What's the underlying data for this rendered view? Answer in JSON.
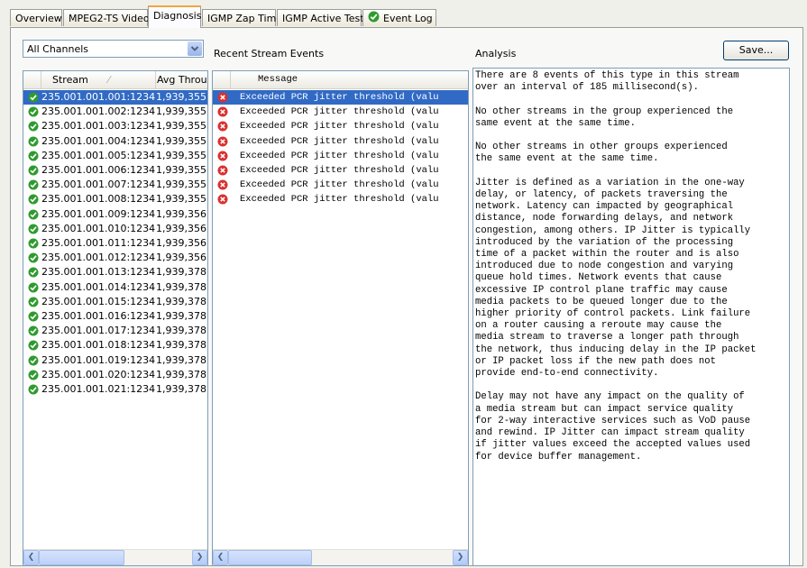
{
  "tabs": [
    {
      "label": "Overview"
    },
    {
      "label": "MPEG2-TS Video"
    },
    {
      "label": "Diagnosis"
    },
    {
      "label": "IGMP Zap Time"
    },
    {
      "label": "IGMP Active Test"
    },
    {
      "label": "Event Log"
    }
  ],
  "channel_select": {
    "value": "All Channels"
  },
  "recent_events_label": "Recent Stream Events",
  "analysis_label": "Analysis",
  "save_button": "Save...",
  "stream_table": {
    "columns": [
      "Stream",
      "Avg Throug"
    ],
    "rows": [
      {
        "stream": "235.001.001.001:1234",
        "avg": "1,939,355"
      },
      {
        "stream": "235.001.001.002:1234",
        "avg": "1,939,355"
      },
      {
        "stream": "235.001.001.003:1234",
        "avg": "1,939,355"
      },
      {
        "stream": "235.001.001.004:1234",
        "avg": "1,939,355"
      },
      {
        "stream": "235.001.001.005:1234",
        "avg": "1,939,355"
      },
      {
        "stream": "235.001.001.006:1234",
        "avg": "1,939,355"
      },
      {
        "stream": "235.001.001.007:1234",
        "avg": "1,939,355"
      },
      {
        "stream": "235.001.001.008:1234",
        "avg": "1,939,355"
      },
      {
        "stream": "235.001.001.009:1234",
        "avg": "1,939,356"
      },
      {
        "stream": "235.001.001.010:1234",
        "avg": "1,939,356"
      },
      {
        "stream": "235.001.001.011:1234",
        "avg": "1,939,356"
      },
      {
        "stream": "235.001.001.012:1234",
        "avg": "1,939,356"
      },
      {
        "stream": "235.001.001.013:1234",
        "avg": "1,939,378"
      },
      {
        "stream": "235.001.001.014:1234",
        "avg": "1,939,378"
      },
      {
        "stream": "235.001.001.015:1234",
        "avg": "1,939,378"
      },
      {
        "stream": "235.001.001.016:1234",
        "avg": "1,939,378"
      },
      {
        "stream": "235.001.001.017:1234",
        "avg": "1,939,378"
      },
      {
        "stream": "235.001.001.018:1234",
        "avg": "1,939,378"
      },
      {
        "stream": "235.001.001.019:1234",
        "avg": "1,939,378"
      },
      {
        "stream": "235.001.001.020:1234",
        "avg": "1,939,378"
      },
      {
        "stream": "235.001.001.021:1234",
        "avg": "1,939,378"
      }
    ]
  },
  "events_table": {
    "column": "Message",
    "rows": [
      "Exceeded PCR jitter threshold (valu",
      "Exceeded PCR jitter threshold (valu",
      "Exceeded PCR jitter threshold (valu",
      "Exceeded PCR jitter threshold (valu",
      "Exceeded PCR jitter threshold (valu",
      "Exceeded PCR jitter threshold (valu",
      "Exceeded PCR jitter threshold (valu",
      "Exceeded PCR jitter threshold (valu"
    ]
  },
  "analysis_text": "There are 8 events of this type in this stream\nover an interval of 185 millisecond(s).\n\nNo other streams in the group experienced the\nsame event at the same time.\n\nNo other streams in other groups experienced\nthe same event at the same time.\n\nJitter is defined as a variation in the one-way\ndelay, or latency, of packets traversing the\nnetwork. Latency can impacted by geographical\ndistance, node forwarding delays, and network\ncongestion, among others. IP Jitter is typically\nintroduced by the variation of the processing\ntime of a packet within the router and is also\nintroduced due to node congestion and varying\nqueue hold times. Network events that cause\nexcessive IP control plane traffic may cause\nmedia packets to be queued longer due to the\nhigher priority of control packets. Link failure\non a router causing a reroute may cause the\nmedia stream to traverse a longer path through\nthe network, thus inducing delay in the IP packet\nor IP packet loss if the new path does not\nprovide end-to-end connectivity.\n\nDelay may not have any impact on the quality of\na media stream but can impact service quality\nfor 2-way interactive services such as VoD pause\nand rewind. IP Jitter can impact stream quality\nif jitter values exceed the accepted values used\nfor device buffer management.",
  "colors": {
    "selection": "#316ac5",
    "ok": "#2e9b2e",
    "error": "#d9302f",
    "active_tab_accent": "#f1a73f"
  },
  "icons": {
    "stream_status": "check-circle-icon",
    "event_status": "error-circle-icon",
    "event_log_tab": "check-circle-icon"
  }
}
